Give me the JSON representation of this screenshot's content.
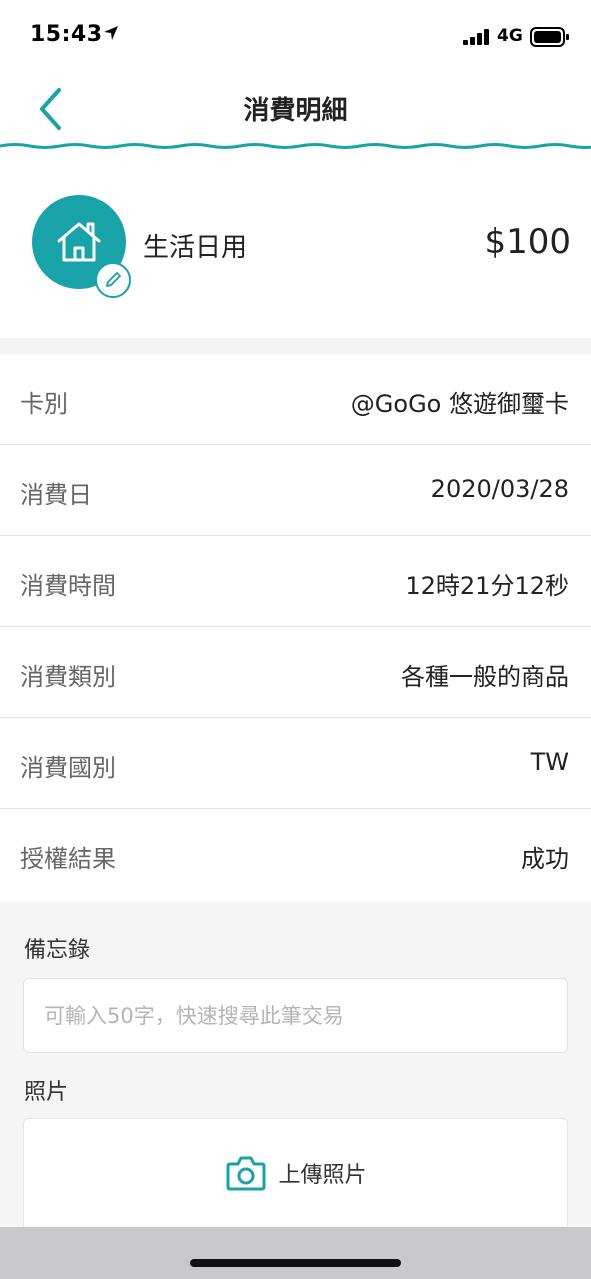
{
  "status_bar": {
    "time": "15:43",
    "network": "4G"
  },
  "header": {
    "title": "消費明細"
  },
  "summary": {
    "category": "生活日用",
    "amount": "$100",
    "category_icon": "house-icon",
    "accent_color": "#17a3a8"
  },
  "details": [
    {
      "label": "卡別",
      "value": "@GoGo 悠遊御璽卡"
    },
    {
      "label": "消費日",
      "value": "2020/03/28"
    },
    {
      "label": "消費時間",
      "value": "12時21分12秒"
    },
    {
      "label": "消費類別",
      "value": "各種一般的商品"
    },
    {
      "label": "消費國別",
      "value": "TW"
    },
    {
      "label": "授權結果",
      "value": "成功"
    }
  ],
  "memo": {
    "label": "備忘錄",
    "placeholder": "可輸入50字，快速搜尋此筆交易"
  },
  "photo": {
    "label": "照片",
    "upload_label": "上傳照片"
  }
}
